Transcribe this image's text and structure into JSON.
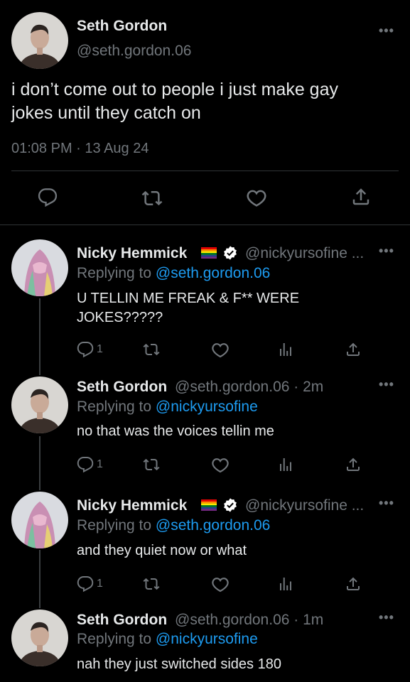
{
  "main_tweet": {
    "author_name": "Seth Gordon",
    "author_handle": "@seth.gordon.06",
    "text_line1": "i don’t come out to people i just make gay",
    "text_line2": "jokes until they catch on",
    "timestamp": "01:08 PM · 13 Aug 24",
    "more": "•••"
  },
  "replies": [
    {
      "author_name": "Nicky Hemmick",
      "author_handle": "@nickyursofine ...",
      "replying_label": "Replying to",
      "replying_to": "@seth.gordon.06",
      "text_line1": "U TELLIN ME FREAK & F** WERE",
      "text_line2": "JOKES?????",
      "reply_count": "1",
      "more": "•••"
    },
    {
      "author_name": "Seth Gordon",
      "author_handle": "@seth.gordon.06 · 2m",
      "replying_label": "Replying to",
      "replying_to": "@nickyursofine",
      "text_line1": "no that was the voices tellin me",
      "reply_count": "1",
      "more": "•••"
    },
    {
      "author_name": "Nicky Hemmick",
      "author_handle": "@nickyursofine ...",
      "replying_label": "Replying to",
      "replying_to": "@seth.gordon.06",
      "text_line1": "and they quiet now or what",
      "reply_count": "1",
      "more": "•••"
    },
    {
      "author_name": "Seth Gordon",
      "author_handle": "@seth.gordon.06 · 1m",
      "replying_label": "Replying to",
      "replying_to": "@nickyursofine",
      "text_line1": "nah they just switched sides 180",
      "more": "•••"
    }
  ],
  "colors": {
    "background": "#000000",
    "text": "#e7e9ea",
    "muted": "#71767b",
    "link": "#1d9bf0",
    "verified": "#ffffff"
  },
  "icons": [
    "reply-icon",
    "retweet-icon",
    "like-icon",
    "share-icon",
    "views-icon",
    "verified-icon",
    "pride-flag-icon",
    "more-icon"
  ]
}
